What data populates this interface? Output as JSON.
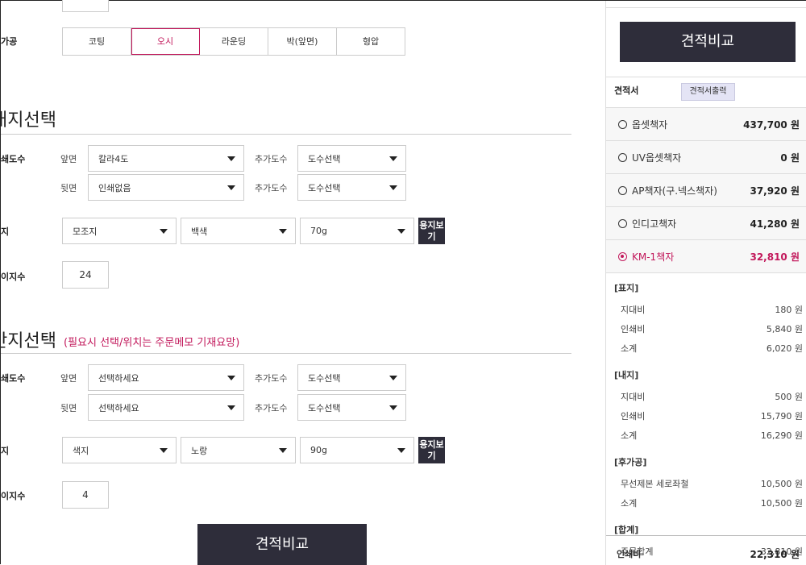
{
  "top_qty": "",
  "finishing": {
    "label": "가공",
    "options": [
      "코팅",
      "오시",
      "라운딩",
      "박(앞면)",
      "형압"
    ],
    "selected_index": 1
  },
  "inner": {
    "title": "내지선택",
    "print_label": "쇄도수",
    "front_label": "앞면",
    "back_label": "뒷면",
    "extra_label": "추가도수",
    "front_value": "칼라4도",
    "front_extra": "도수선택",
    "back_value": "인쇄없음",
    "back_extra": "도수선택",
    "paper_label": "지",
    "paper_type": "모조지",
    "paper_color": "백색",
    "paper_weight": "70g",
    "paper_btn": "용지보기",
    "pages_label": "이지수",
    "pages_value": "24"
  },
  "insert": {
    "title": "간지선택",
    "note": "(필요시 선택/위치는 주문메모 기재요망)",
    "print_label": "쇄도수",
    "front_label": "앞면",
    "back_label": "뒷면",
    "extra_label": "추가도수",
    "front_value": "선택하세요",
    "front_extra": "도수선택",
    "back_value": "선택하세요",
    "back_extra": "도수선택",
    "paper_label": "지",
    "paper_type": "색지",
    "paper_color": "노랑",
    "paper_weight": "90g",
    "paper_btn": "용지보기",
    "pages_label": "이지수",
    "pages_value": "4"
  },
  "compare_btn": "견적비교",
  "panel": {
    "compare_btn": "견적비교",
    "estimate_label": "견적서",
    "print_estimate_btn": "견적서출력",
    "estimates": [
      {
        "name": "옵셋책자",
        "price": "437,700 원",
        "selected": false
      },
      {
        "name": "UV옵셋책자",
        "price": "0 원",
        "selected": false
      },
      {
        "name": "AP책자(구.넥스책자)",
        "price": "37,920 원",
        "selected": false
      },
      {
        "name": "인디고책자",
        "price": "41,280 원",
        "selected": false
      },
      {
        "name": "KM-1책자",
        "price": "32,810 원",
        "selected": true
      }
    ],
    "groups": [
      {
        "head": "[표지]",
        "lines": [
          [
            "지대비",
            "180 원"
          ],
          [
            "인쇄비",
            "5,840 원"
          ],
          [
            "소계",
            "6,020 원"
          ]
        ]
      },
      {
        "head": "[내지]",
        "lines": [
          [
            "지대비",
            "500 원"
          ],
          [
            "인쇄비",
            "15,790 원"
          ],
          [
            "소계",
            "16,290 원"
          ]
        ]
      },
      {
        "head": "[후가공]",
        "lines": [
          [
            "무선제본 세로좌철",
            "10,500 원"
          ],
          [
            "소계",
            "10,500 원"
          ]
        ]
      },
      {
        "head": "[합계]",
        "lines": [
          [
            "주문합계",
            "32,810 원"
          ]
        ]
      }
    ],
    "footer_label": "인쇄비",
    "footer_value": "22,310 원"
  },
  "colors": {
    "accent": "#c2185b",
    "dark": "#2e2d3a"
  }
}
